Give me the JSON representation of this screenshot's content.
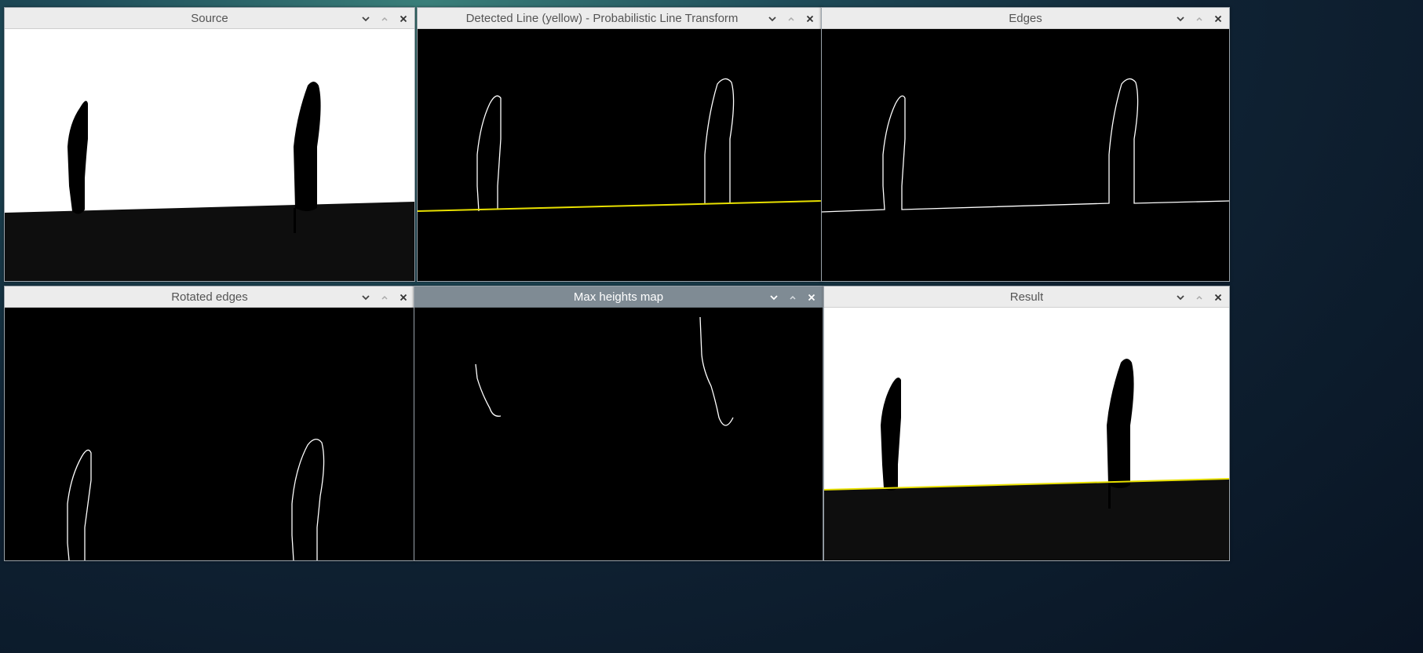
{
  "windows": {
    "source": {
      "title": "Source"
    },
    "detected": {
      "title": "Detected Line (yellow) - Probabilistic Line Transform"
    },
    "edges": {
      "title": "Edges"
    },
    "rotated": {
      "title": "Rotated edges"
    },
    "maxheights": {
      "title": "Max heights map"
    },
    "result": {
      "title": "Result"
    }
  },
  "icons": {
    "minimize": "chevron-down-icon",
    "maximize": "chevron-up-icon",
    "close": "close-icon"
  },
  "colors": {
    "detected_line": "#e8e000",
    "edge_stroke": "#ffffff",
    "ground": "#0e0e0e",
    "sky": "#ffffff",
    "active_titlebar": "#7f8b94"
  }
}
